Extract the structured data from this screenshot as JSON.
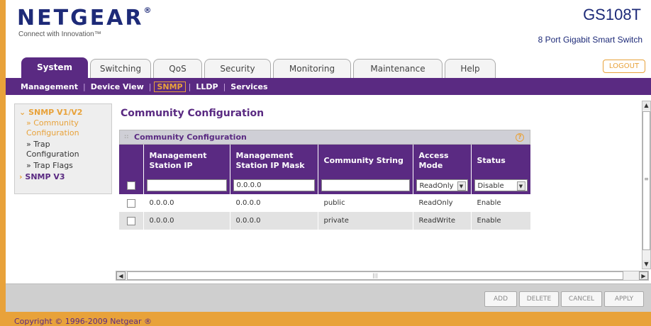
{
  "header": {
    "logo": "NETGEAR",
    "logo_mark": "®",
    "tagline": "Connect with Innovation™",
    "model": "GS108T",
    "subtitle": "8 Port Gigabit Smart Switch",
    "logout": "LOGOUT"
  },
  "tabs": [
    "System",
    "Switching",
    "QoS",
    "Security",
    "Monitoring",
    "Maintenance",
    "Help"
  ],
  "active_tab": "System",
  "subnav": [
    "Management",
    "Device View",
    "SNMP",
    "LLDP",
    "Services"
  ],
  "active_subnav": "SNMP",
  "leftnav": {
    "snmp_v1v2": "SNMP V1/V2",
    "community_line1": "» Community",
    "community_line2": "Configuration",
    "trap_line1": "» Trap",
    "trap_line2": "Configuration",
    "trap_flags": "» Trap Flags",
    "snmp_v3": "SNMP V3"
  },
  "page_title": "Community Configuration",
  "panel_title": "Community Configuration",
  "help_icon": "?",
  "table": {
    "headers": {
      "mgmt_ip": "Management Station IP",
      "mgmt_mask": "Management Station IP Mask",
      "community": "Community String",
      "access": "Access Mode",
      "status": "Status"
    },
    "input_row": {
      "mgmt_ip": "",
      "mgmt_mask": "0.0.0.0",
      "community": "",
      "access": "ReadOnly",
      "status": "Disable"
    },
    "rows": [
      {
        "ip": "0.0.0.0",
        "mask": "0.0.0.0",
        "community": "public",
        "access": "ReadOnly",
        "status": "Enable"
      },
      {
        "ip": "0.0.0.0",
        "mask": "0.0.0.0",
        "community": "private",
        "access": "ReadWrite",
        "status": "Enable"
      }
    ]
  },
  "buttons": {
    "add": "ADD",
    "delete": "DELETE",
    "cancel": "CANCEL",
    "apply": "APPLY"
  },
  "footer": "Copyright © 1996-2009 Netgear ®",
  "colors": {
    "purple": "#5a2a82",
    "orange": "#e8a23a",
    "navy": "#1d2a78"
  }
}
